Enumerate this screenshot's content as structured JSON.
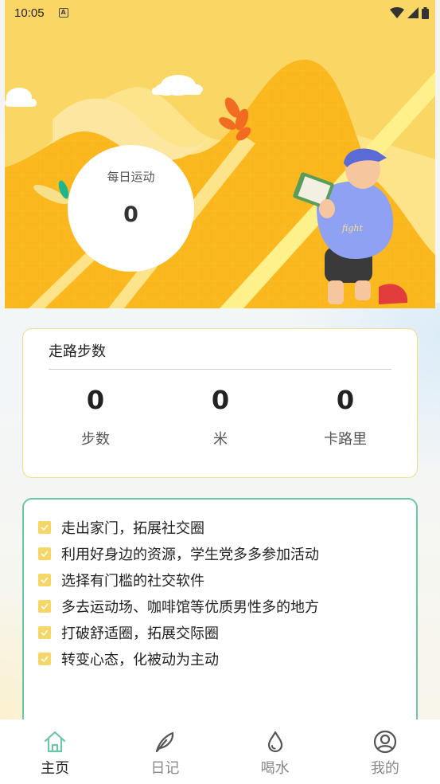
{
  "status_bar": {
    "time": "10:05",
    "notification_icon": "a-icon",
    "icons": [
      "wifi-icon",
      "signal-icon",
      "battery-icon"
    ]
  },
  "hero": {
    "daily_title": "每日运动",
    "daily_value": "0",
    "illustration": "boy-reading-book"
  },
  "steps": {
    "title": "走路步数",
    "stats": [
      {
        "value": "0",
        "label": "步数"
      },
      {
        "value": "0",
        "label": "米"
      },
      {
        "value": "0",
        "label": "卡路里"
      }
    ]
  },
  "tips": [
    "走出家门，拓展社交圈",
    "利用好身边的资源，学生党多多参加活动",
    "选择有门槛的社交软件",
    "多去运动场、咖啡馆等优质男性多的地方",
    "打破舒适圈，拓展交际圈",
    "转变心态，化被动为主动"
  ],
  "nav": [
    {
      "label": "主页",
      "icon": "home-icon",
      "active": true
    },
    {
      "label": "日记",
      "icon": "feather-icon",
      "active": false
    },
    {
      "label": "喝水",
      "icon": "water-drop-icon",
      "active": false
    },
    {
      "label": "我的",
      "icon": "user-icon",
      "active": false
    }
  ],
  "colors": {
    "hero_yellow": "#fbd54c",
    "card_border_yellow": "#f0dc82",
    "card_border_green": "#6cc5a5",
    "check_yellow": "#f6d666",
    "nav_active": "#6cc5a5"
  }
}
